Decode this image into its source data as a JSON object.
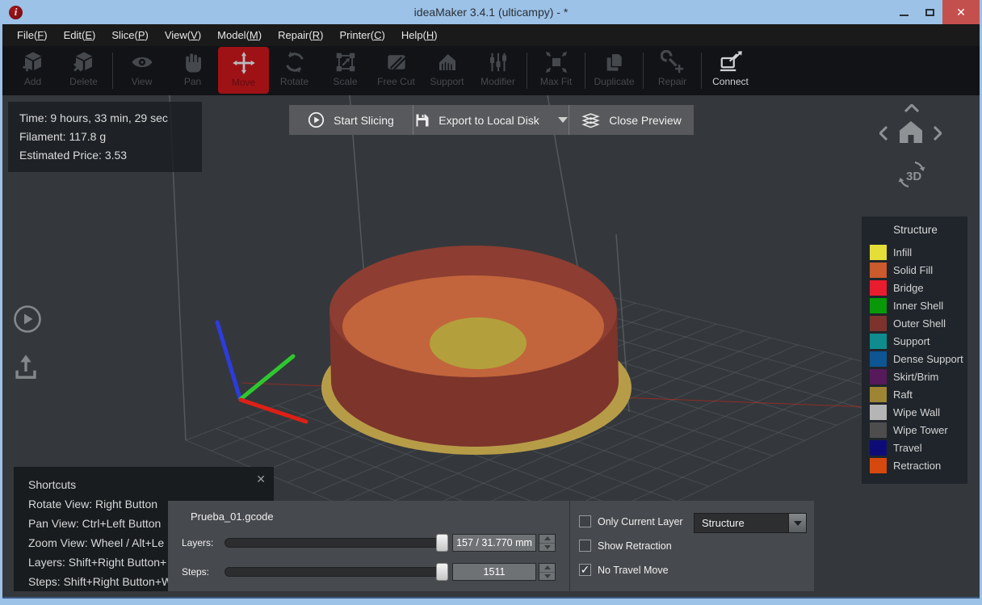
{
  "window": {
    "title": "ideaMaker 3.4.1 (ulticampy) - *",
    "close_glyph": "✕",
    "app_icon_letter": "i"
  },
  "menu": {
    "items": [
      {
        "pre": "File(",
        "key": "F",
        "post": ")"
      },
      {
        "pre": "Edit(",
        "key": "E",
        "post": ")"
      },
      {
        "pre": "Slice(",
        "key": "P",
        "post": ")"
      },
      {
        "pre": "View(",
        "key": "V",
        "post": ")"
      },
      {
        "pre": "Model(",
        "key": "M",
        "post": ")"
      },
      {
        "pre": "Repair(",
        "key": "R",
        "post": ")"
      },
      {
        "pre": "Printer(",
        "key": "C",
        "post": ")"
      },
      {
        "pre": "Help(",
        "key": "H",
        "post": ")"
      }
    ]
  },
  "toolbar": {
    "active": "Move",
    "items": [
      "Add",
      "Delete",
      "View",
      "Pan",
      "Move",
      "Rotate",
      "Scale",
      "Free Cut",
      "Support",
      "Modifier",
      "Max Fit",
      "Duplicate",
      "Repair",
      "Connect"
    ]
  },
  "stats": {
    "time": "Time: 9 hours, 33 min, 29 sec",
    "filament": "Filament: 117.8 g",
    "price": "Estimated Price: 3.53"
  },
  "preview_bar": {
    "start_slicing": "Start Slicing",
    "export": "Export to Local Disk",
    "close_preview": "Close Preview"
  },
  "nav": {
    "label_3d": "3D"
  },
  "legend": {
    "title": "Structure",
    "items": [
      {
        "label": "Infill",
        "color": "#e5de39"
      },
      {
        "label": "Solid Fill",
        "color": "#cb5a2d"
      },
      {
        "label": "Bridge",
        "color": "#e81c2e"
      },
      {
        "label": "Inner Shell",
        "color": "#089808"
      },
      {
        "label": "Outer Shell",
        "color": "#7b332b"
      },
      {
        "label": "Support",
        "color": "#0e8c8e"
      },
      {
        "label": "Dense Support",
        "color": "#0e5593"
      },
      {
        "label": "Skirt/Brim",
        "color": "#56195a"
      },
      {
        "label": "Raft",
        "color": "#9d8533"
      },
      {
        "label": "Wipe Wall",
        "color": "#b5b5b5"
      },
      {
        "label": "Wipe Tower",
        "color": "#4d4d4d"
      },
      {
        "label": "Travel",
        "color": "#0d0c77"
      },
      {
        "label": "Retraction",
        "color": "#d6490e"
      }
    ]
  },
  "shortcuts": {
    "title": "Shortcuts",
    "close": "✕",
    "lines": [
      "Rotate View: Right Button",
      "Pan View: Ctrl+Left Button",
      "Zoom View: Wheel / Alt+Le",
      "Layers: Shift+Right Button+",
      "Steps: Shift+Right Button+W"
    ]
  },
  "slicer_panel": {
    "filename": "Prueba_01.gcode",
    "layers": {
      "label": "Layers:",
      "value": "157 / 31.770 mm"
    },
    "steps": {
      "label": "Steps:",
      "value": "1511"
    }
  },
  "options": {
    "checkmark": "✓",
    "only_current_layer": {
      "label": "Only Current Layer",
      "checked": false
    },
    "show_retraction": {
      "label": "Show Retraction",
      "checked": false
    },
    "no_travel_move": {
      "label": "No Travel Move",
      "checked": true
    },
    "view_mode": "Structure"
  },
  "scene": {
    "background": "#34383c",
    "grid_line": "#5c6166",
    "frame_line": "#70757a",
    "raft": "#b79c48",
    "outer_shell_side": "#7c342b",
    "outer_shell_rim": "#8d3d31",
    "solid_fill_top": "#c2653c",
    "infill_center": "#b3a03c",
    "axis_x": "#dd2016",
    "axis_y": "#2ec82e",
    "axis_z": "#2d3cdc"
  }
}
